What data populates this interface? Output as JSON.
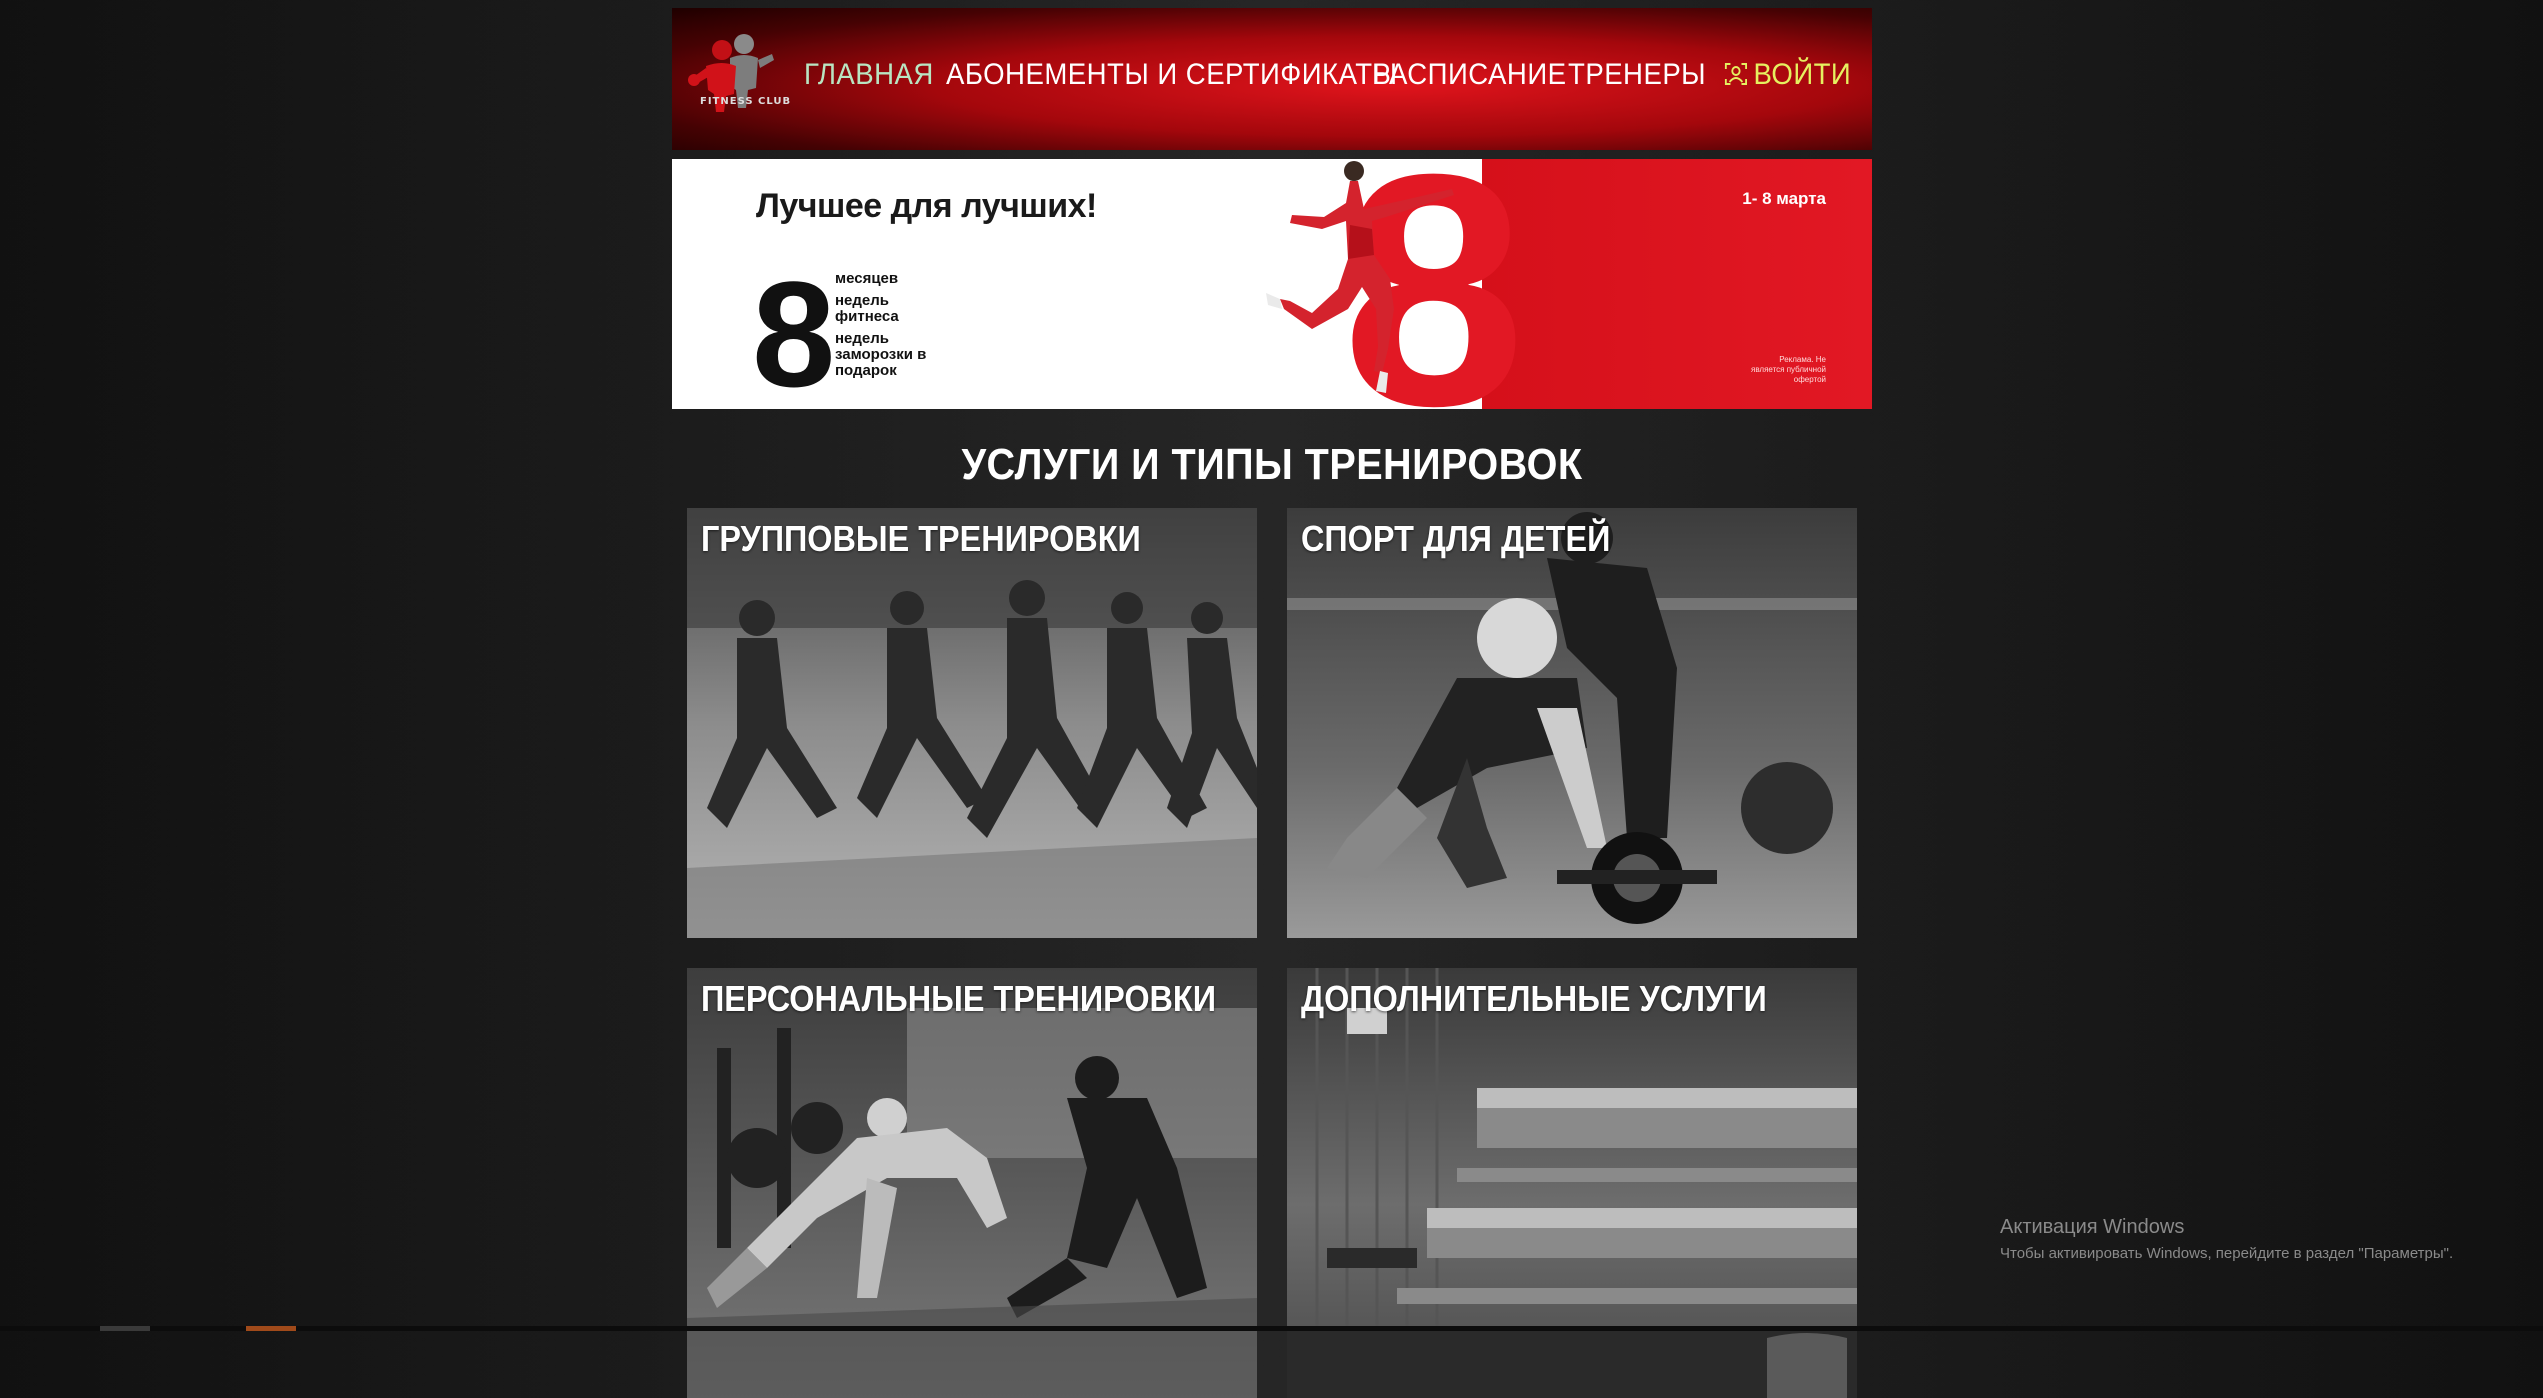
{
  "header": {
    "logo_text": "FITNESS CLUB",
    "nav": [
      "ГЛАВНАЯ",
      "АБОНЕМЕНТЫ И СЕРТИФИКАТЫ",
      "РАСПИСАНИЕ",
      "ТРЕНЕРЫ"
    ],
    "login_label": "ВОЙТИ",
    "active_color": "#b9e5c2",
    "login_color": "#e6f060"
  },
  "banner": {
    "title": "Лучшее для лучших!",
    "number": "8",
    "line1": "месяцев",
    "line2": "недель фитнеса",
    "line3": "недель заморозки в подарок",
    "date": "1- 8 марта",
    "note": "Реклама. Не является публичной офертой",
    "accent": "#e21824"
  },
  "services": {
    "title": "УСЛУГИ И ТИПЫ ТРЕНИРОВОК",
    "cards": [
      {
        "title": "ГРУППОВЫЕ ТРЕНИРОВКИ"
      },
      {
        "title": "СПОРТ ДЛЯ ДЕТЕЙ"
      },
      {
        "title": "ПЕРСОНАЛЬНЫЕ ТРЕНИРОВКИ"
      },
      {
        "title": "ДОПОЛНИТЕЛЬНЫЕ УСЛУГИ"
      }
    ]
  },
  "windows_activation": {
    "title": "Активация Windows",
    "subtitle": "Чтобы активировать Windows, перейдите в раздел \"Параметры\"."
  }
}
